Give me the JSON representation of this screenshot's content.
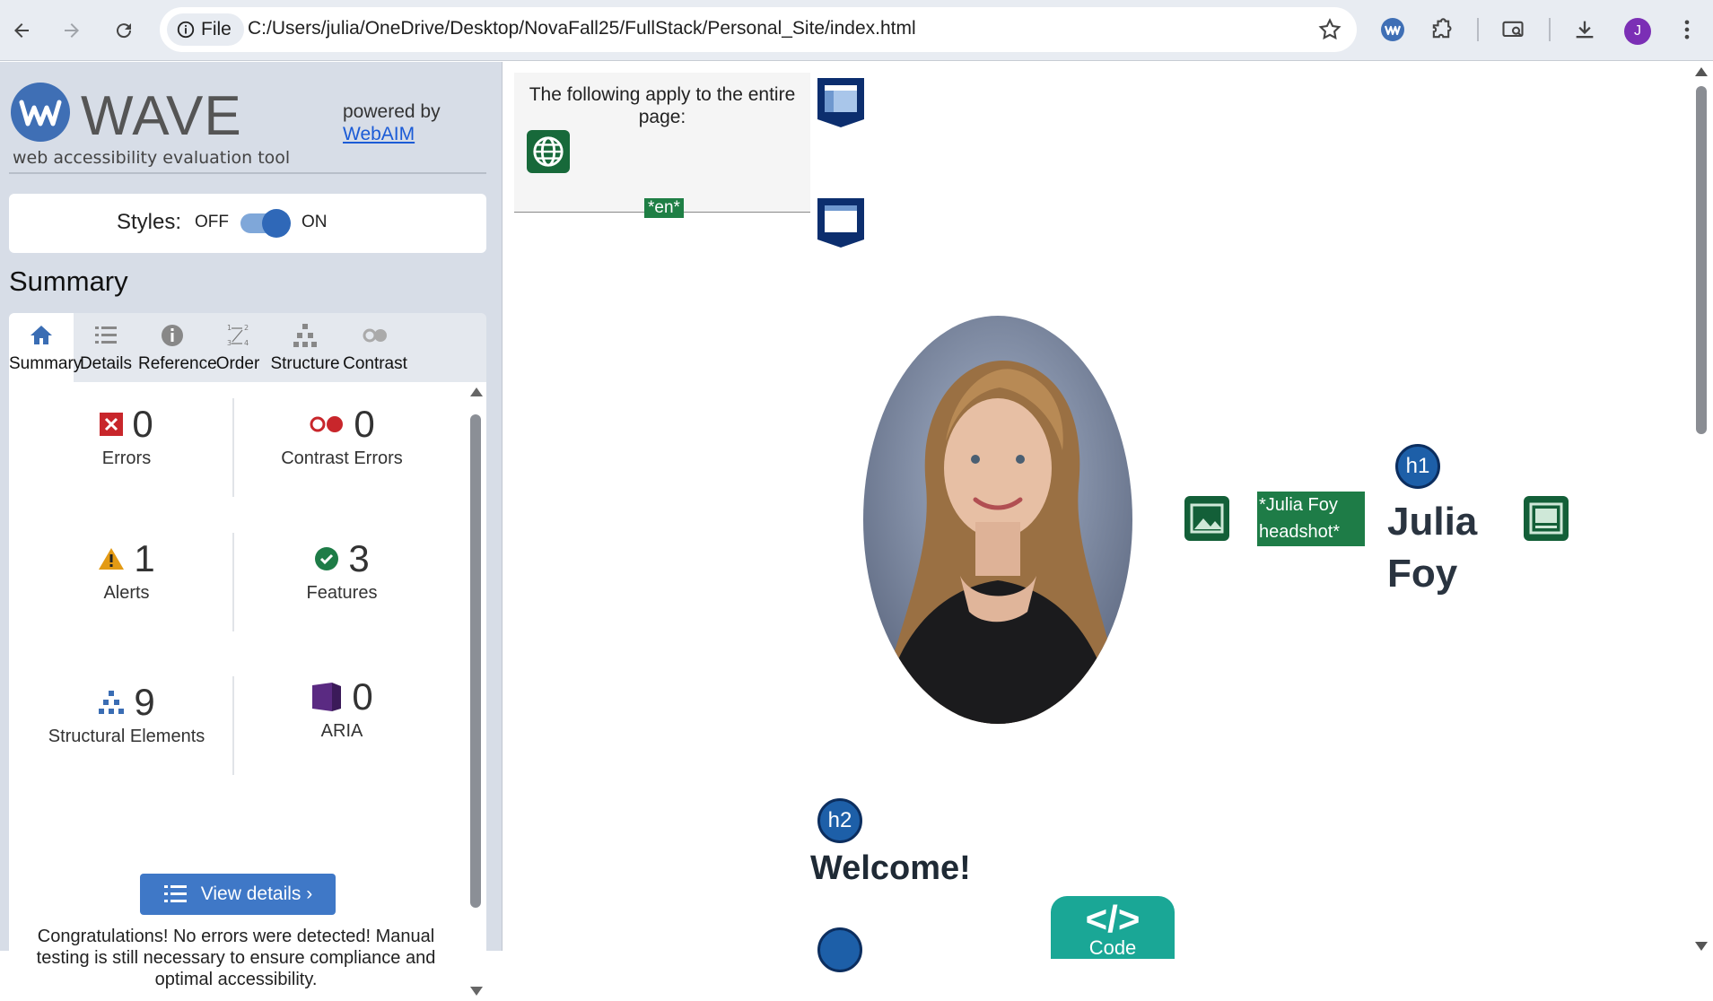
{
  "browser": {
    "chip_label": "File",
    "url": "C:/Users/julia/OneDrive/Desktop/NovaFall25/FullStack/Personal_Site/index.html",
    "avatar_letter": "J"
  },
  "wave": {
    "logo_text": "WAVE",
    "subtitle": "web accessibility evaluation tool",
    "powered_by": "powered by",
    "powered_link": "WebAIM",
    "styles_label": "Styles:",
    "styles_off": "OFF",
    "styles_on": "ON",
    "summary_title": "Summary",
    "tabs": [
      {
        "label": "Summary",
        "icon": "home-icon"
      },
      {
        "label": "Details",
        "icon": "list-icon"
      },
      {
        "label": "Reference",
        "icon": "info-icon"
      },
      {
        "label": "Order",
        "icon": "order-icon"
      },
      {
        "label": "Structure",
        "icon": "structure-icon"
      },
      {
        "label": "Contrast",
        "icon": "contrast-icon"
      }
    ],
    "stats": {
      "errors": {
        "value": "0",
        "label": "Errors"
      },
      "contrast_errors": {
        "value": "0",
        "label": "Contrast Errors"
      },
      "alerts": {
        "value": "1",
        "label": "Alerts"
      },
      "features": {
        "value": "3",
        "label": "Features"
      },
      "structural": {
        "value": "9",
        "label": "Structural Elements"
      },
      "aria": {
        "value": "0",
        "label": "ARIA"
      }
    },
    "view_details": "View details ›",
    "congrats": "Congratulations! No errors were detected! Manual testing is still necessary to ensure compliance and optimal accessibility."
  },
  "page": {
    "entire_page_text": "The following apply to the entire page:",
    "lang_tag": "*en*",
    "alt_tag": "*Julia Foy headshot*",
    "h1_badge": "h1",
    "h1_text_line1": "Julia",
    "h1_text_line2": "Foy",
    "h2_badge": "h2",
    "h2_text": "Welcome!",
    "code_glyph": "</>",
    "code_word": "Code"
  },
  "colors": {
    "wave_blue": "#3f78c7",
    "feature_green": "#1e7c47",
    "error_red": "#c8262b",
    "alert_orange": "#e39a14",
    "aria_purple": "#5a2a82"
  }
}
